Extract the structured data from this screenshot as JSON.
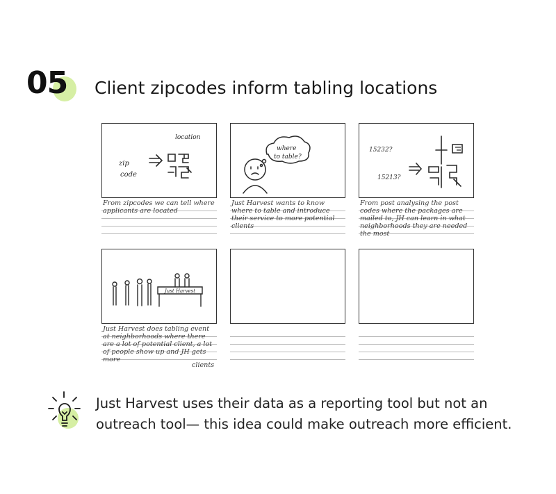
{
  "section": {
    "number": "05",
    "title": "Client zipcodes inform tabling locations"
  },
  "panels": [
    {
      "sketch_labels": [
        "location",
        "zip",
        "code"
      ],
      "caption": "From zipcodes we can tell where applicants are located"
    },
    {
      "sketch_labels": [
        "where",
        "to table?"
      ],
      "caption": "Just Harvest wants to know where to table and introduce their service to more potential clients"
    },
    {
      "sketch_labels": [
        "15232?",
        "15213?"
      ],
      "caption": "From post analysing the post codes where the packages are mailed to, JH can learn in what neighborhoods they are needed the most"
    },
    {
      "sketch_labels": [
        "Just Harvest"
      ],
      "caption": "Just Harvest does tabling event at neighborhoods where there are a lot of potential client, a lot of people show up and JH gets more",
      "caption_end": "clients"
    },
    {
      "sketch_labels": [],
      "caption": ""
    },
    {
      "sketch_labels": [],
      "caption": ""
    }
  ],
  "insight": {
    "icon": "lightbulb-icon",
    "line1": "Just Harvest uses their data as a reporting tool but not an",
    "line2": "outreach tool— this idea could make outreach more efficient."
  },
  "colors": {
    "accent_highlight": "#d6efa4",
    "sketch_ink": "#2a2a2a",
    "rule_lines": "#b9b9b9"
  }
}
